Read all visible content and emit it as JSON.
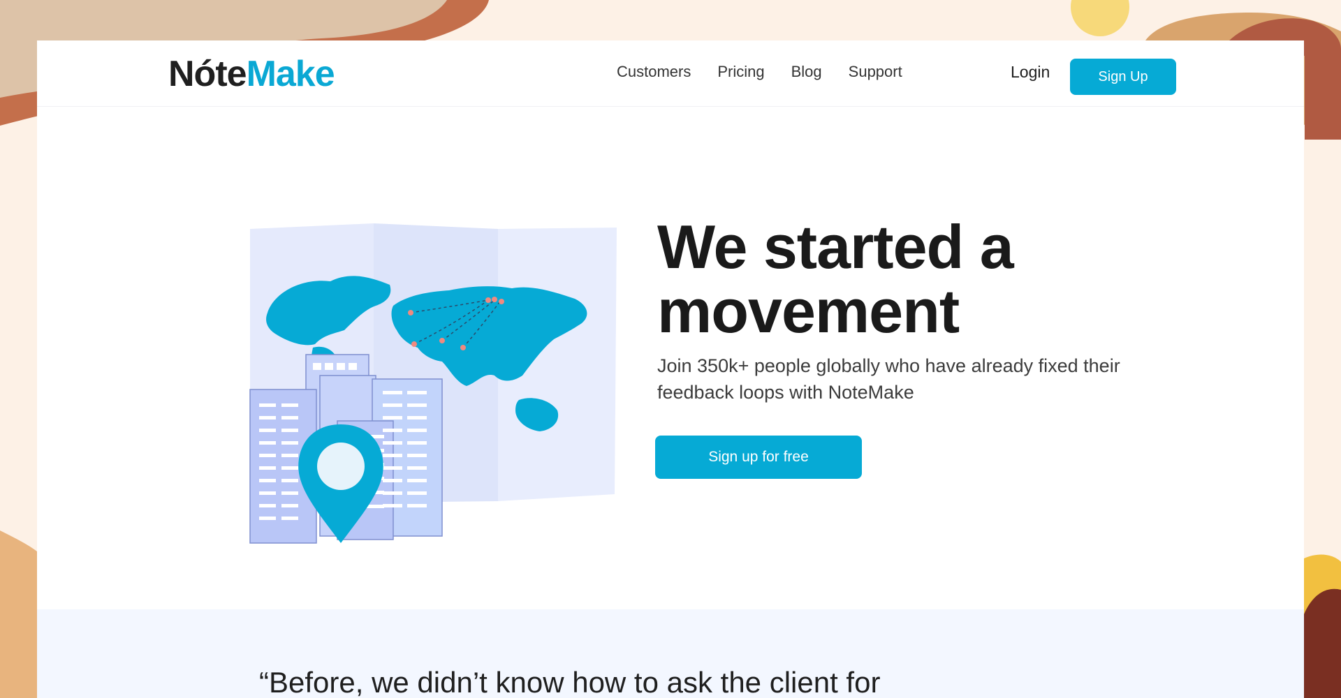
{
  "brand": {
    "logo_part1": "Nóte",
    "logo_part2": "Make",
    "accent_color": "#06aad5",
    "background_color": "#fdf1e6"
  },
  "nav": {
    "links": [
      {
        "label": "Customers"
      },
      {
        "label": "Pricing"
      },
      {
        "label": "Blog"
      },
      {
        "label": "Support"
      }
    ],
    "login_label": "Login",
    "signup_label": "Sign Up"
  },
  "hero": {
    "headline": "We started a movement",
    "subtext": "Join 350k+ people globally who have already fixed their feedback loops with NoteMake",
    "cta_label": "Sign up for free",
    "illustration_icon": "world-map-with-buildings-and-location-pin-icon"
  },
  "testimonial": {
    "quote": "“Before, we didn’t know how to ask the client for"
  }
}
